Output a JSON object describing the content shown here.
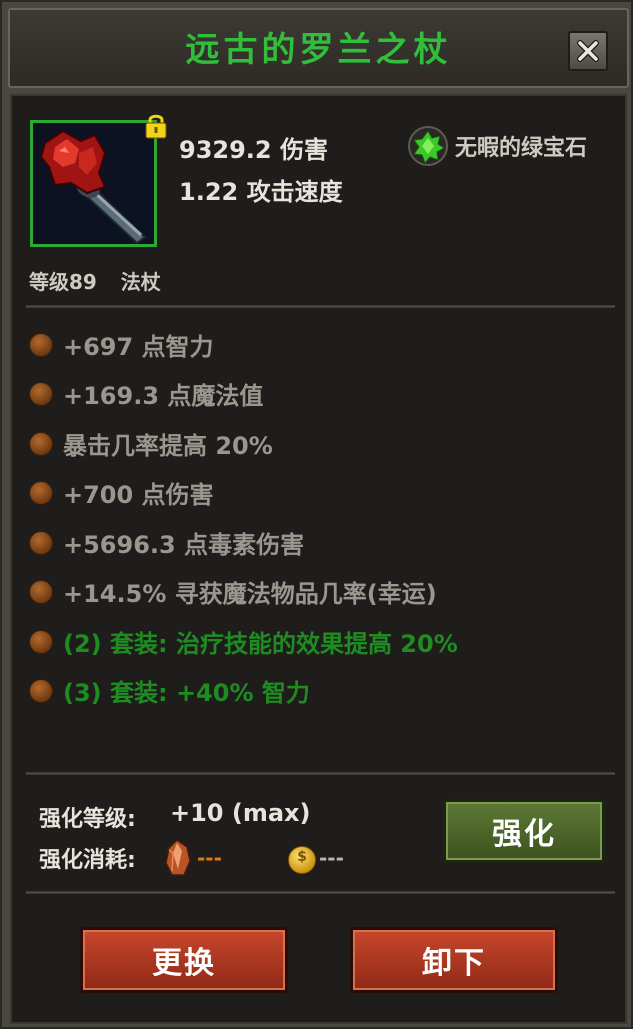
{
  "title": "远古的罗兰之杖",
  "item": {
    "damage": "9329.2 伤害",
    "attack_speed": "1.22 攻击速度",
    "gem_label": "无暇的绿宝石",
    "level_label": "等级89",
    "type_label": "法杖"
  },
  "attributes": [
    {
      "text": "+697 点智力",
      "color": "gray"
    },
    {
      "text": "+169.3 点魔法值",
      "color": "gray"
    },
    {
      "text": "暴击几率提高 20%",
      "color": "gray"
    },
    {
      "text": "+700 点伤害",
      "color": "gray"
    },
    {
      "text": "+5696.3 点毒素伤害",
      "color": "gray"
    },
    {
      "text": "+14.5% 寻获魔法物品几率(幸运)",
      "color": "gray"
    },
    {
      "text": "(2) 套装: 治疗技能的效果提高 20%",
      "color": "green"
    },
    {
      "text": "(3) 套装: +40% 智力",
      "color": "green"
    }
  ],
  "enhance": {
    "level_label": "强化等级:",
    "level_value": "+10 (max)",
    "cost_label": "强化消耗:",
    "ore_cost": "---",
    "gold_cost": "---",
    "coin_symbol": "$",
    "button_label": "强化"
  },
  "actions": {
    "replace_label": "更换",
    "unequip_label": "卸下"
  },
  "colors": {
    "title_green": "#2fbf3a",
    "set_green": "#1f8c22",
    "attr_gray": "#9b978f",
    "cost_orange": "#e07a12"
  }
}
